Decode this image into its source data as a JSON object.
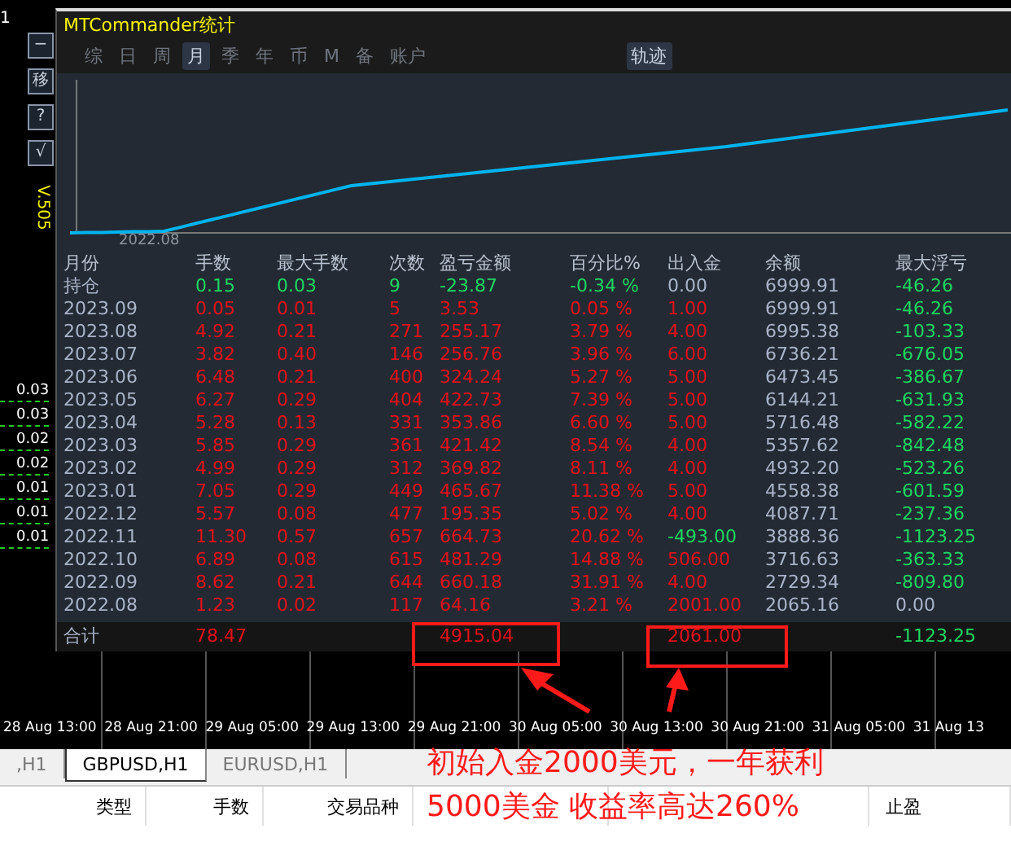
{
  "side": {
    "fragment": "1",
    "buttons": [
      "−",
      "移",
      "?",
      "√"
    ],
    "version": "V.505",
    "lots": [
      "0.03",
      "0.03",
      "0.02",
      "0.02",
      "0.01",
      "0.01",
      "0.01"
    ]
  },
  "panel": {
    "title": "MTCommander统计",
    "tabs": [
      {
        "label": "综",
        "selected": false
      },
      {
        "label": "日",
        "selected": false
      },
      {
        "label": "周",
        "selected": false
      },
      {
        "label": "月",
        "selected": true
      },
      {
        "label": "季",
        "selected": false
      },
      {
        "label": "年",
        "selected": false
      },
      {
        "label": "币",
        "selected": false
      },
      {
        "label": "M",
        "selected": false
      },
      {
        "label": "备",
        "selected": false
      },
      {
        "label": "账户",
        "selected": false
      }
    ],
    "track_tab": {
      "label": "轨迹",
      "selected": true
    },
    "chart_label": "2022.08",
    "columns": [
      "月份",
      "手数",
      "最大手数",
      "次数",
      "盈亏金额",
      "百分比%",
      "出入金",
      "余额",
      "最大浮亏"
    ],
    "rows": [
      {
        "kind": "open",
        "cells": [
          {
            "text": "持仓",
            "color": "#a9b4c8"
          },
          {
            "text": "0.15",
            "color": "#1ed760"
          },
          {
            "text": "0.03",
            "color": "#1ed760"
          },
          {
            "text": "9",
            "color": "#1ed760"
          },
          {
            "text": "-23.87",
            "color": "#1ed760"
          },
          {
            "text": "-0.34 %",
            "color": "#1ed760"
          },
          {
            "text": "0.00",
            "color": "#a9b4c8"
          },
          {
            "text": "6999.91",
            "color": "#a9b4c8"
          },
          {
            "text": "-46.26",
            "color": "#1ed760"
          }
        ]
      },
      {
        "kind": "month",
        "cells": [
          {
            "text": "2023.09",
            "color": "#a9b4c8"
          },
          {
            "text": "0.05",
            "color": "#e5101a"
          },
          {
            "text": "0.01",
            "color": "#e5101a"
          },
          {
            "text": "5",
            "color": "#e5101a"
          },
          {
            "text": "3.53",
            "color": "#e5101a"
          },
          {
            "text": "0.05 %",
            "color": "#e5101a"
          },
          {
            "text": "1.00",
            "color": "#e5101a"
          },
          {
            "text": "6999.91",
            "color": "#a9b4c8"
          },
          {
            "text": "-46.26",
            "color": "#1ed760"
          }
        ]
      },
      {
        "kind": "month",
        "cells": [
          {
            "text": "2023.08",
            "color": "#a9b4c8"
          },
          {
            "text": "4.92",
            "color": "#e5101a"
          },
          {
            "text": "0.21",
            "color": "#e5101a"
          },
          {
            "text": "271",
            "color": "#e5101a"
          },
          {
            "text": "255.17",
            "color": "#e5101a"
          },
          {
            "text": "3.79 %",
            "color": "#e5101a"
          },
          {
            "text": "4.00",
            "color": "#e5101a"
          },
          {
            "text": "6995.38",
            "color": "#a9b4c8"
          },
          {
            "text": "-103.33",
            "color": "#1ed760"
          }
        ]
      },
      {
        "kind": "month",
        "cells": [
          {
            "text": "2023.07",
            "color": "#a9b4c8"
          },
          {
            "text": "3.82",
            "color": "#e5101a"
          },
          {
            "text": "0.40",
            "color": "#e5101a"
          },
          {
            "text": "146",
            "color": "#e5101a"
          },
          {
            "text": "256.76",
            "color": "#e5101a"
          },
          {
            "text": "3.96 %",
            "color": "#e5101a"
          },
          {
            "text": "6.00",
            "color": "#e5101a"
          },
          {
            "text": "6736.21",
            "color": "#a9b4c8"
          },
          {
            "text": "-676.05",
            "color": "#1ed760"
          }
        ]
      },
      {
        "kind": "month",
        "cells": [
          {
            "text": "2023.06",
            "color": "#a9b4c8"
          },
          {
            "text": "6.48",
            "color": "#e5101a"
          },
          {
            "text": "0.21",
            "color": "#e5101a"
          },
          {
            "text": "400",
            "color": "#e5101a"
          },
          {
            "text": "324.24",
            "color": "#e5101a"
          },
          {
            "text": "5.27 %",
            "color": "#e5101a"
          },
          {
            "text": "5.00",
            "color": "#e5101a"
          },
          {
            "text": "6473.45",
            "color": "#a9b4c8"
          },
          {
            "text": "-386.67",
            "color": "#1ed760"
          }
        ]
      },
      {
        "kind": "month",
        "cells": [
          {
            "text": "2023.05",
            "color": "#a9b4c8"
          },
          {
            "text": "6.27",
            "color": "#e5101a"
          },
          {
            "text": "0.29",
            "color": "#e5101a"
          },
          {
            "text": "404",
            "color": "#e5101a"
          },
          {
            "text": "422.73",
            "color": "#e5101a"
          },
          {
            "text": "7.39 %",
            "color": "#e5101a"
          },
          {
            "text": "5.00",
            "color": "#e5101a"
          },
          {
            "text": "6144.21",
            "color": "#a9b4c8"
          },
          {
            "text": "-631.93",
            "color": "#1ed760"
          }
        ]
      },
      {
        "kind": "month",
        "cells": [
          {
            "text": "2023.04",
            "color": "#a9b4c8"
          },
          {
            "text": "5.28",
            "color": "#e5101a"
          },
          {
            "text": "0.13",
            "color": "#e5101a"
          },
          {
            "text": "331",
            "color": "#e5101a"
          },
          {
            "text": "353.86",
            "color": "#e5101a"
          },
          {
            "text": "6.60 %",
            "color": "#e5101a"
          },
          {
            "text": "5.00",
            "color": "#e5101a"
          },
          {
            "text": "5716.48",
            "color": "#a9b4c8"
          },
          {
            "text": "-582.22",
            "color": "#1ed760"
          }
        ]
      },
      {
        "kind": "month",
        "cells": [
          {
            "text": "2023.03",
            "color": "#a9b4c8"
          },
          {
            "text": "5.85",
            "color": "#e5101a"
          },
          {
            "text": "0.29",
            "color": "#e5101a"
          },
          {
            "text": "361",
            "color": "#e5101a"
          },
          {
            "text": "421.42",
            "color": "#e5101a"
          },
          {
            "text": "8.54 %",
            "color": "#e5101a"
          },
          {
            "text": "4.00",
            "color": "#e5101a"
          },
          {
            "text": "5357.62",
            "color": "#a9b4c8"
          },
          {
            "text": "-842.48",
            "color": "#1ed760"
          }
        ]
      },
      {
        "kind": "month",
        "cells": [
          {
            "text": "2023.02",
            "color": "#a9b4c8"
          },
          {
            "text": "4.99",
            "color": "#e5101a"
          },
          {
            "text": "0.29",
            "color": "#e5101a"
          },
          {
            "text": "312",
            "color": "#e5101a"
          },
          {
            "text": "369.82",
            "color": "#e5101a"
          },
          {
            "text": "8.11 %",
            "color": "#e5101a"
          },
          {
            "text": "4.00",
            "color": "#e5101a"
          },
          {
            "text": "4932.20",
            "color": "#a9b4c8"
          },
          {
            "text": "-523.26",
            "color": "#1ed760"
          }
        ]
      },
      {
        "kind": "month",
        "cells": [
          {
            "text": "2023.01",
            "color": "#a9b4c8"
          },
          {
            "text": "7.05",
            "color": "#e5101a"
          },
          {
            "text": "0.29",
            "color": "#e5101a"
          },
          {
            "text": "449",
            "color": "#e5101a"
          },
          {
            "text": "465.67",
            "color": "#e5101a"
          },
          {
            "text": "11.38 %",
            "color": "#e5101a"
          },
          {
            "text": "5.00",
            "color": "#e5101a"
          },
          {
            "text": "4558.38",
            "color": "#a9b4c8"
          },
          {
            "text": "-601.59",
            "color": "#1ed760"
          }
        ]
      },
      {
        "kind": "month",
        "cells": [
          {
            "text": "2022.12",
            "color": "#a9b4c8"
          },
          {
            "text": "5.57",
            "color": "#e5101a"
          },
          {
            "text": "0.08",
            "color": "#e5101a"
          },
          {
            "text": "477",
            "color": "#e5101a"
          },
          {
            "text": "195.35",
            "color": "#e5101a"
          },
          {
            "text": "5.02 %",
            "color": "#e5101a"
          },
          {
            "text": "4.00",
            "color": "#e5101a"
          },
          {
            "text": "4087.71",
            "color": "#a9b4c8"
          },
          {
            "text": "-237.36",
            "color": "#1ed760"
          }
        ]
      },
      {
        "kind": "month",
        "cells": [
          {
            "text": "2022.11",
            "color": "#a9b4c8"
          },
          {
            "text": "11.30",
            "color": "#e5101a"
          },
          {
            "text": "0.57",
            "color": "#e5101a"
          },
          {
            "text": "657",
            "color": "#e5101a"
          },
          {
            "text": "664.73",
            "color": "#e5101a"
          },
          {
            "text": "20.62 %",
            "color": "#e5101a"
          },
          {
            "text": "-493.00",
            "color": "#1ed760"
          },
          {
            "text": "3888.36",
            "color": "#a9b4c8"
          },
          {
            "text": "-1123.25",
            "color": "#1ed760"
          }
        ]
      },
      {
        "kind": "month",
        "cells": [
          {
            "text": "2022.10",
            "color": "#a9b4c8"
          },
          {
            "text": "6.89",
            "color": "#e5101a"
          },
          {
            "text": "0.08",
            "color": "#e5101a"
          },
          {
            "text": "615",
            "color": "#e5101a"
          },
          {
            "text": "481.29",
            "color": "#e5101a"
          },
          {
            "text": "14.88 %",
            "color": "#e5101a"
          },
          {
            "text": "506.00",
            "color": "#e5101a"
          },
          {
            "text": "3716.63",
            "color": "#a9b4c8"
          },
          {
            "text": "-363.33",
            "color": "#1ed760"
          }
        ]
      },
      {
        "kind": "month",
        "cells": [
          {
            "text": "2022.09",
            "color": "#a9b4c8"
          },
          {
            "text": "8.62",
            "color": "#e5101a"
          },
          {
            "text": "0.21",
            "color": "#e5101a"
          },
          {
            "text": "644",
            "color": "#e5101a"
          },
          {
            "text": "660.18",
            "color": "#e5101a"
          },
          {
            "text": "31.91 %",
            "color": "#e5101a"
          },
          {
            "text": "4.00",
            "color": "#e5101a"
          },
          {
            "text": "2729.34",
            "color": "#a9b4c8"
          },
          {
            "text": "-809.80",
            "color": "#1ed760"
          }
        ]
      },
      {
        "kind": "month",
        "cells": [
          {
            "text": "2022.08",
            "color": "#a9b4c8"
          },
          {
            "text": "1.23",
            "color": "#e5101a"
          },
          {
            "text": "0.02",
            "color": "#e5101a"
          },
          {
            "text": "117",
            "color": "#e5101a"
          },
          {
            "text": "64.16",
            "color": "#e5101a"
          },
          {
            "text": "3.21 %",
            "color": "#e5101a"
          },
          {
            "text": "2001.00",
            "color": "#e5101a"
          },
          {
            "text": "2065.16",
            "color": "#a9b4c8"
          },
          {
            "text": "0.00",
            "color": "#a9b4c8"
          }
        ]
      },
      {
        "kind": "total",
        "cells": [
          {
            "text": "合计",
            "color": "#a9b4c8"
          },
          {
            "text": "78.47",
            "color": "#e5101a"
          },
          null,
          null,
          {
            "text": "4915.04",
            "color": "#e5101a"
          },
          null,
          {
            "text": "2061.00",
            "color": "#e5101a"
          },
          null,
          {
            "text": "-1123.25",
            "color": "#1ed760"
          }
        ]
      }
    ]
  },
  "time_axis": [
    "28 Aug 13:00",
    "28 Aug 21:00",
    "29 Aug 05:00",
    "29 Aug 13:00",
    "29 Aug 21:00",
    "30 Aug 05:00",
    "30 Aug 13:00",
    "30 Aug 21:00",
    "31 Aug 05:00",
    "31 Aug 13"
  ],
  "chart_tabs": [
    {
      "label": ",H1",
      "selected": false
    },
    {
      "label": "GBPUSD,H1",
      "selected": true
    },
    {
      "label": "EURUSD,H1",
      "selected": false
    }
  ],
  "trade_columns": [
    {
      "kind": "shown",
      "label": "类型"
    },
    {
      "kind": "shown",
      "label": "手数"
    },
    {
      "kind": "shown",
      "label": "交易品种"
    },
    {
      "kind": "covered"
    },
    {
      "kind": "covered"
    },
    {
      "kind": "shown",
      "label": "止盈"
    }
  ],
  "annotation": {
    "lines": [
      "初始入金2000美元，一年获利",
      "5000美金 收益率高达260%"
    ]
  }
}
